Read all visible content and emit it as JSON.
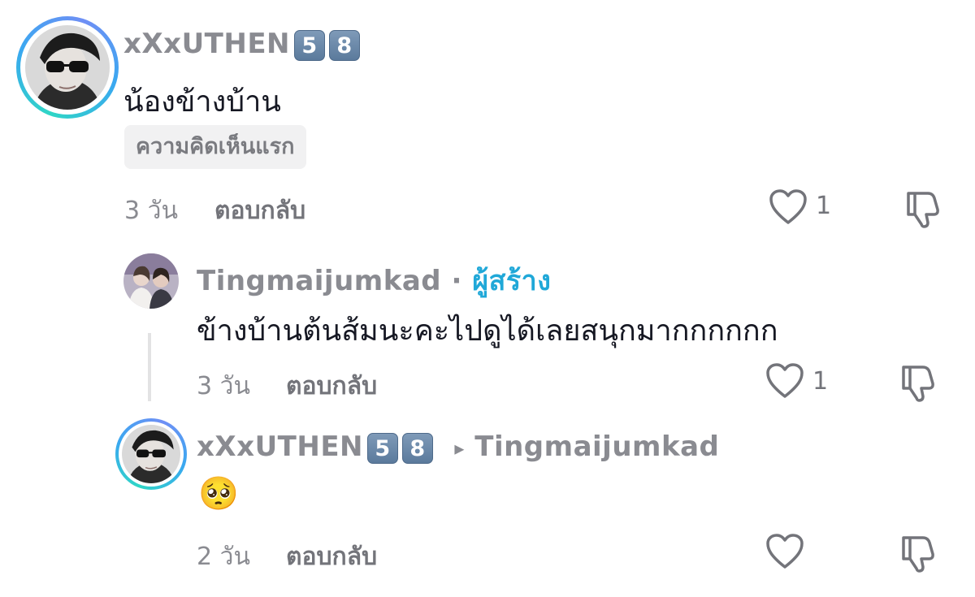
{
  "comments": [
    {
      "username": "xXxUTHEN",
      "badges": [
        "5",
        "8"
      ],
      "text": "น้องข้างบ้าน",
      "tag": "ความคิดเห็นแรก",
      "time": "3 วัน",
      "reply_label": "ตอบกลับ",
      "likes": "1"
    },
    {
      "username": "Tingmaijumkad",
      "separator": "·",
      "creator_label": "ผู้สร้าง",
      "text": "ข้างบ้านต้นส้มนะคะไปดูได้เลยสนุกมากกกกกก",
      "time": "3 วัน",
      "reply_label": "ตอบกลับ",
      "likes": "1"
    },
    {
      "username": "xXxUTHEN",
      "badges": [
        "5",
        "8"
      ],
      "reply_arrow": "▸",
      "reply_to": "Tingmaijumkad",
      "text": "🥺",
      "time": "2 วัน",
      "reply_label": "ตอบกลับ",
      "likes": ""
    }
  ],
  "colors": {
    "accent": "#20a8d8",
    "muted": "#8a8b91",
    "text": "#161823"
  },
  "icons": [
    "heart-icon",
    "dislike-icon"
  ]
}
